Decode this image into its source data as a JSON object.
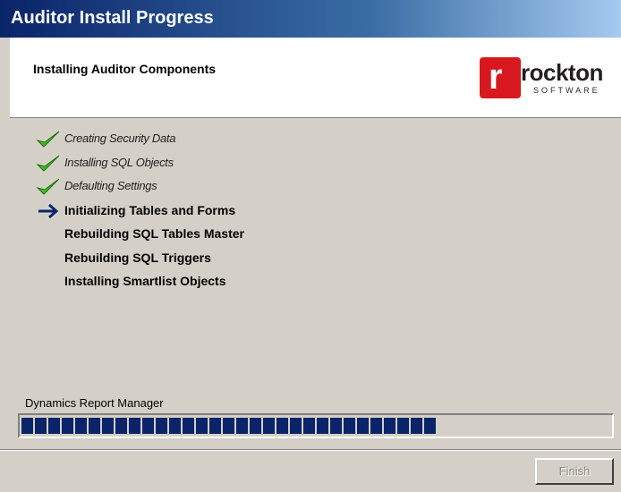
{
  "window": {
    "title": "Auditor Install Progress"
  },
  "header": {
    "heading": "Installing Auditor Components",
    "logo": {
      "mark": "r",
      "name": "rockton",
      "sub": "SOFTWARE",
      "color": "#d7181f"
    }
  },
  "steps": [
    {
      "label": "Creating Security Data",
      "status": "done",
      "icon": "check-icon"
    },
    {
      "label": "Installing SQL Objects",
      "status": "done",
      "icon": "check-icon"
    },
    {
      "label": "Defaulting Settings",
      "status": "done",
      "icon": "check-icon"
    },
    {
      "label": "Initializing Tables and Forms",
      "status": "active",
      "icon": "arrow-right-icon"
    },
    {
      "label": "Rebuilding SQL Tables Master",
      "status": "pending",
      "icon": ""
    },
    {
      "label": "Rebuilding SQL Triggers",
      "status": "pending",
      "icon": ""
    },
    {
      "label": "Installing Smartlist Objects",
      "status": "pending",
      "icon": ""
    }
  ],
  "progress": {
    "label": "Dynamics Report Manager",
    "fraction": 0.71,
    "color": "#0a246a"
  },
  "buttons": {
    "finish": "Finish"
  }
}
